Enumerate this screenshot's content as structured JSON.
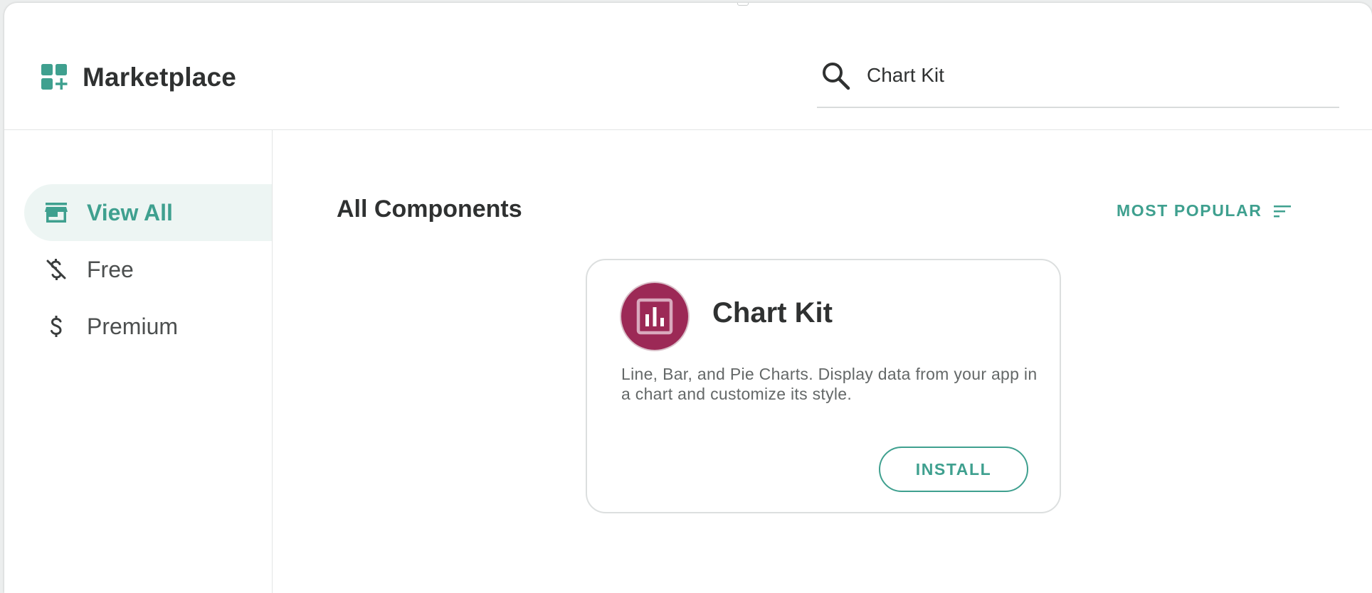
{
  "header": {
    "title": "Marketplace",
    "icon": "apps-add-icon"
  },
  "search": {
    "value": "Chart Kit",
    "icon": "search-icon"
  },
  "sidebar": {
    "items": [
      {
        "label": "View All",
        "icon": "storefront-icon",
        "active": true
      },
      {
        "label": "Free",
        "icon": "money-off-icon",
        "active": false
      },
      {
        "label": "Premium",
        "icon": "dollar-icon",
        "active": false
      }
    ]
  },
  "main": {
    "section_title": "All Components",
    "sort_label": "MOST POPULAR",
    "sort_icon": "sort-icon",
    "cards": [
      {
        "title": "Chart Kit",
        "description": "Line, Bar, and Pie Charts. Display data from your app in a chart and customize its style.",
        "button_label": "INSTALL",
        "icon": "bar-chart-icon",
        "icon_color": "#9c2956"
      }
    ]
  },
  "colors": {
    "accent": "#3fa08f",
    "active_bg": "#edf5f3",
    "text_primary": "#2f3131",
    "text_secondary": "#646868"
  }
}
